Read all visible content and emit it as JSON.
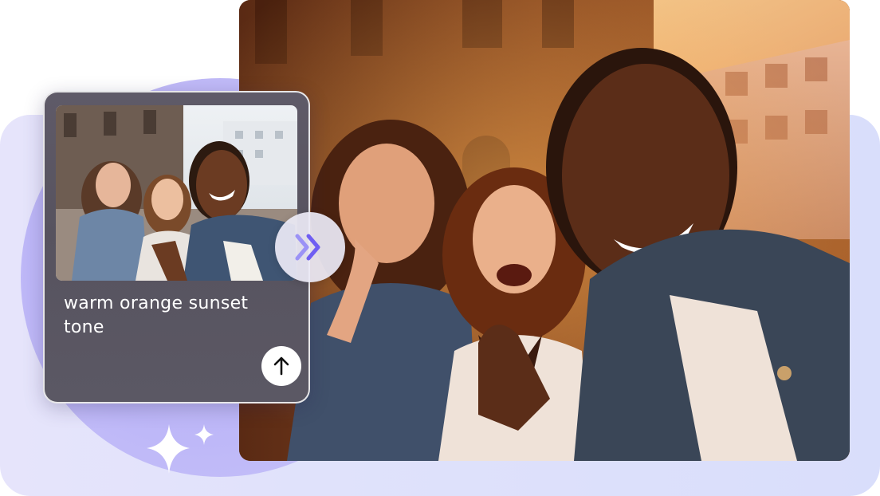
{
  "prompt": {
    "text": "warm orange sunset tone"
  },
  "icons": {
    "submit": "arrow-up-icon",
    "connector": "double-chevron-right-icon",
    "sparkle": "sparkle-icon"
  },
  "colors": {
    "accent": "#7a6cf5",
    "background_band": "#dfe1fb",
    "circle": "#bdb6f8",
    "card": "#5a5663"
  }
}
